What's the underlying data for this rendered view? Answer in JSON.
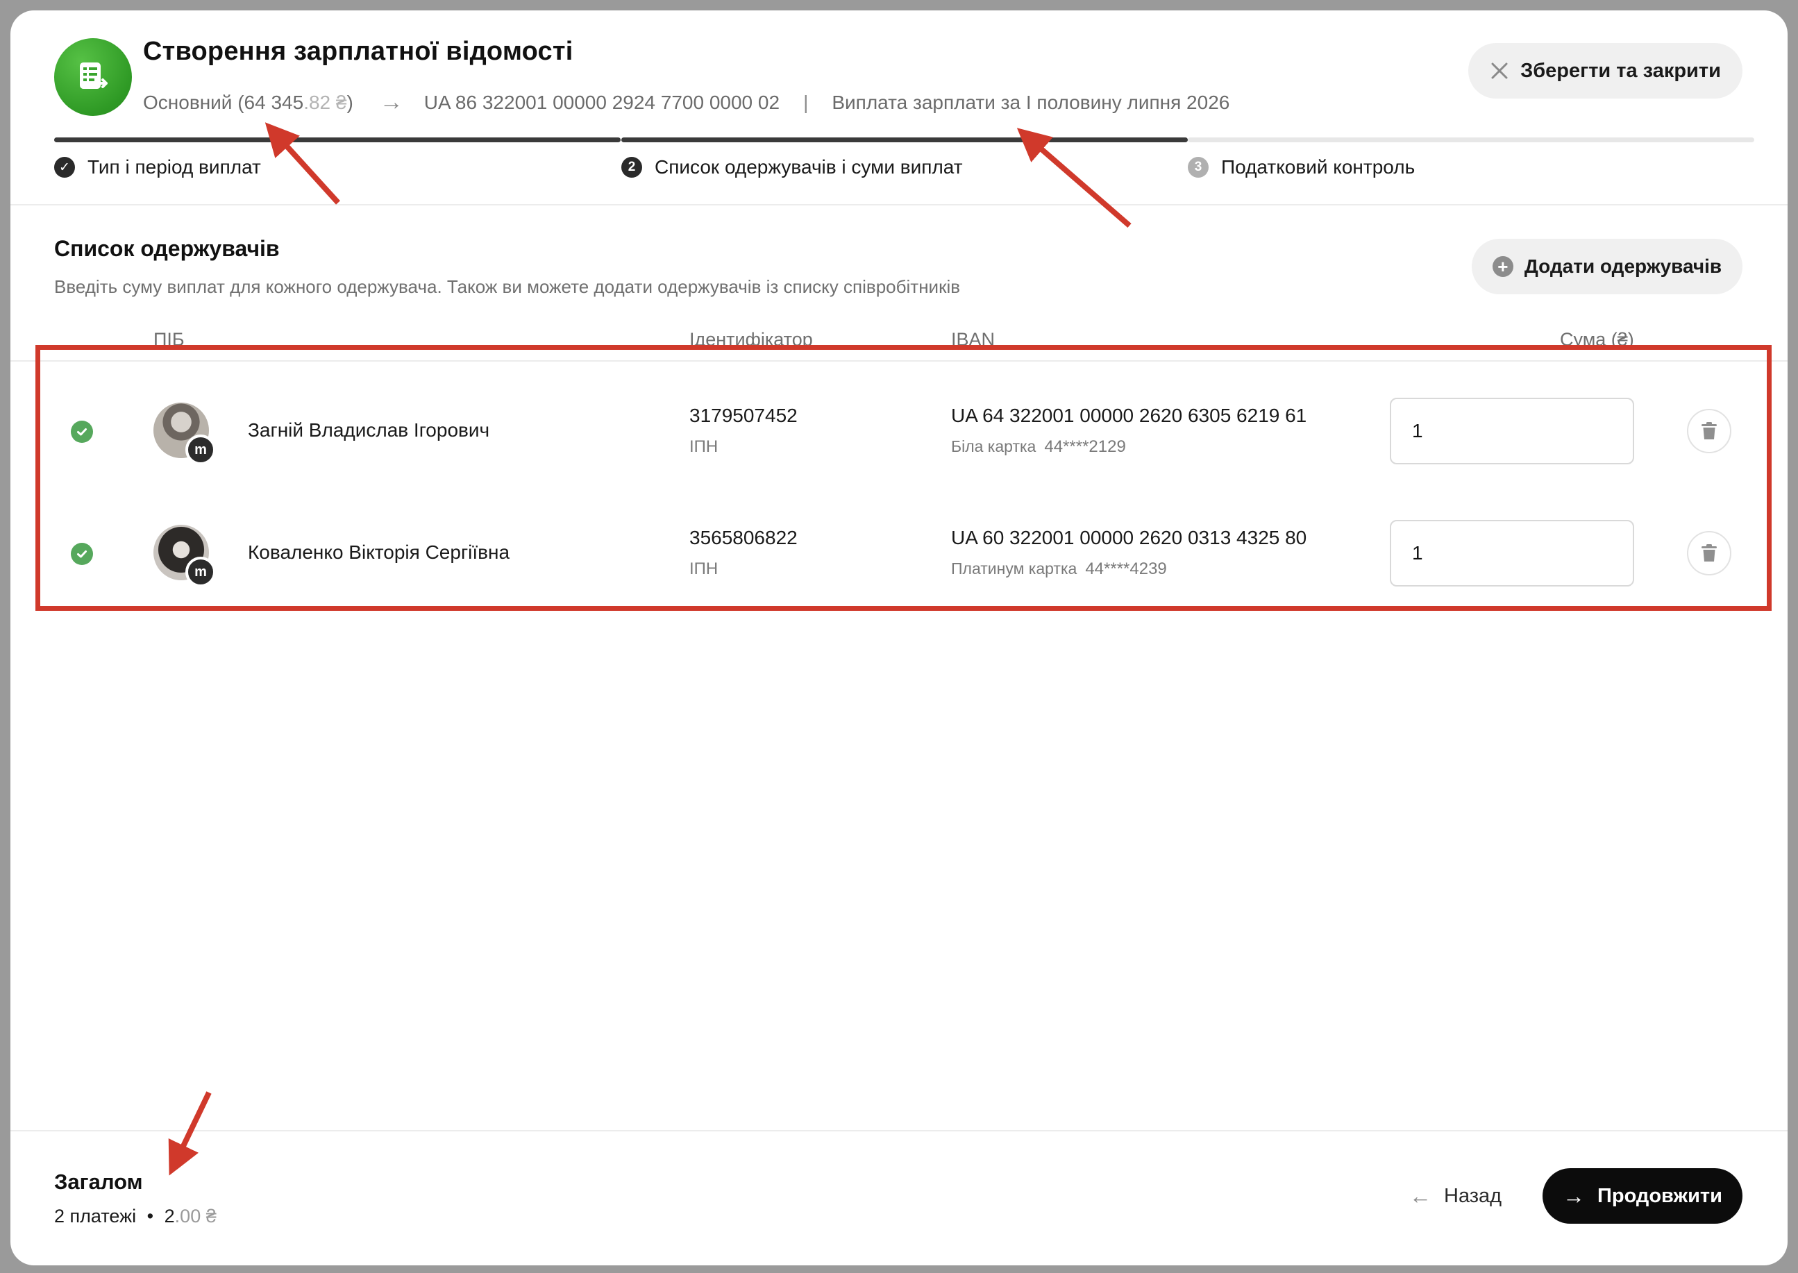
{
  "header": {
    "title": "Створення зарплатної відомості",
    "account_name": "Основний (64 345",
    "account_cents": ".82 ₴",
    "account_close": ")",
    "arrow_glyph": "→",
    "iban": "UA 86 322001 00000 2924 7700 0000 02",
    "separator": "|",
    "payment_description": "Виплата зарплати за I половину липня 2026",
    "close_button": "Зберегти та закрити"
  },
  "stepper": {
    "steps": [
      {
        "label": "Тип і період виплат",
        "mark": "✓",
        "state": "done"
      },
      {
        "label": "Список одержувачів і суми виплат",
        "mark": "2",
        "state": "active"
      },
      {
        "label": "Податковий контроль",
        "mark": "3",
        "state": "pending"
      }
    ]
  },
  "recipients": {
    "title": "Список одержувачів",
    "description": "Введіть суму виплат для кожного одержувача. Також ви можете додати одержувачів із списку співробітників",
    "add_button": "Додати одержувачів",
    "columns": {
      "name": "ПІБ",
      "identifier": "Ідентифікатор",
      "iban": "IBAN",
      "amount": "Сума (₴)"
    },
    "rows": [
      {
        "name": "Загній Владислав Ігорович",
        "badge": "m",
        "identifier": "3179507452",
        "identifier_type": "ІПН",
        "iban": "UA 64 322001 00000 2620 6305 6219 61",
        "card_type": "Біла картка",
        "card_number": "44****2129",
        "amount": "1"
      },
      {
        "name": "Коваленко Вікторія Сергіївна",
        "badge": "m",
        "identifier": "3565806822",
        "identifier_type": "ІПН",
        "iban": "UA 60 322001 00000 2620 0313 4325 80",
        "card_type": "Платинум картка",
        "card_number": "44****4239",
        "amount": "1"
      }
    ]
  },
  "footer": {
    "total_label": "Загалом",
    "payments_count": "2 платежі",
    "bullet": "•",
    "total_whole": "2",
    "total_cents": ".00 ₴",
    "back_button": "Назад",
    "continue_button": "Продовжити"
  },
  "colors": {
    "accent_green": "#3aa52e",
    "annotation_red": "#d0392b",
    "primary_button": "#0c0c0c"
  }
}
